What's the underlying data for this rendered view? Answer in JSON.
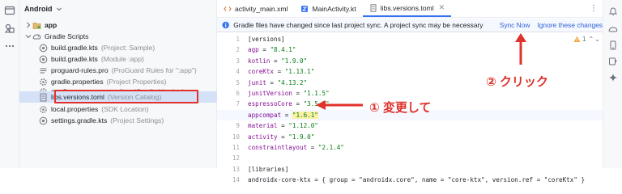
{
  "project_panel": {
    "title": "Android",
    "items": [
      {
        "label": "app",
        "hint": "",
        "icon": "folder-icon",
        "bold": true
      },
      {
        "label": "Gradle Scripts",
        "hint": "",
        "icon": "gradle-scripts-icon",
        "bold": false
      },
      {
        "label": "build.gradle.kts",
        "hint": "(Project: Sample)",
        "icon": "gradle-file-icon"
      },
      {
        "label": "build.gradle.kts",
        "hint": "(Module :app)",
        "icon": "gradle-file-icon"
      },
      {
        "label": "proguard-rules.pro",
        "hint": "(ProGuard Rules for \":app\")",
        "icon": "text-file-icon"
      },
      {
        "label": "gradle.properties",
        "hint": "(Project Properties)",
        "icon": "gear-file-icon"
      },
      {
        "label": "gradle-wrapper.properties",
        "hint": "(Gradle Version)",
        "icon": "gear-file-icon"
      },
      {
        "label": "libs.versions.toml",
        "hint": "(Version Catalog)",
        "icon": "toml-file-icon"
      },
      {
        "label": "local.properties",
        "hint": "(SDK Location)",
        "icon": "gear-file-icon"
      },
      {
        "label": "settings.gradle.kts",
        "hint": "(Project Settings)",
        "icon": "gradle-file-icon"
      }
    ]
  },
  "tabs": [
    {
      "label": "activity_main.xml",
      "icon": "xml-file-icon",
      "active": false
    },
    {
      "label": "MainActivity.kt",
      "icon": "kotlin-file-icon",
      "active": false
    },
    {
      "label": "libs.versions.toml",
      "icon": "toml-file-icon",
      "active": true
    }
  ],
  "banner": {
    "message": "Gradle files have changed since last project sync. A project sync may be necessary for the IDE ...",
    "sync_now": "Sync Now",
    "ignore": "Ignore these changes"
  },
  "editor": {
    "warning_count": "1",
    "lines": [
      {
        "num": "1",
        "text": "[versions]"
      },
      {
        "num": "2",
        "key": "agp",
        "value": "\"8.4.1\""
      },
      {
        "num": "3",
        "key": "kotlin",
        "value": "\"1.9.0\""
      },
      {
        "num": "4",
        "key": "coreKtx",
        "value": "\"1.13.1\""
      },
      {
        "num": "5",
        "key": "junit",
        "value": "\"4.13.2\""
      },
      {
        "num": "6",
        "key": "junitVersion",
        "value": "\"1.1.5\""
      },
      {
        "num": "7",
        "key": "espressoCore",
        "value": "\"3.5.1\""
      },
      {
        "num": "8",
        "key": "appcompat",
        "value": "\"1.6.1\""
      },
      {
        "num": "9",
        "key": "material",
        "value": "\"1.12.0\""
      },
      {
        "num": "10",
        "key": "activity",
        "value": "\"1.9.0\""
      },
      {
        "num": "11",
        "key": "constraintlayout",
        "value": "\"2.1.4\""
      },
      {
        "num": "12",
        "text": ""
      },
      {
        "num": "13",
        "text": "[libraries]"
      },
      {
        "num": "14",
        "text": "androidx-core-ktx = { group = \"androidx.core\", name = \"core-ktx\", version.ref = \"coreKtx\" }"
      }
    ]
  },
  "annotations": {
    "change": "① 変更して",
    "click": "② クリック"
  },
  "colors": {
    "annotation": "#e0322b",
    "accent": "#3574f0",
    "link": "#2f63d6",
    "string": "#067d17",
    "key": "#871094"
  }
}
